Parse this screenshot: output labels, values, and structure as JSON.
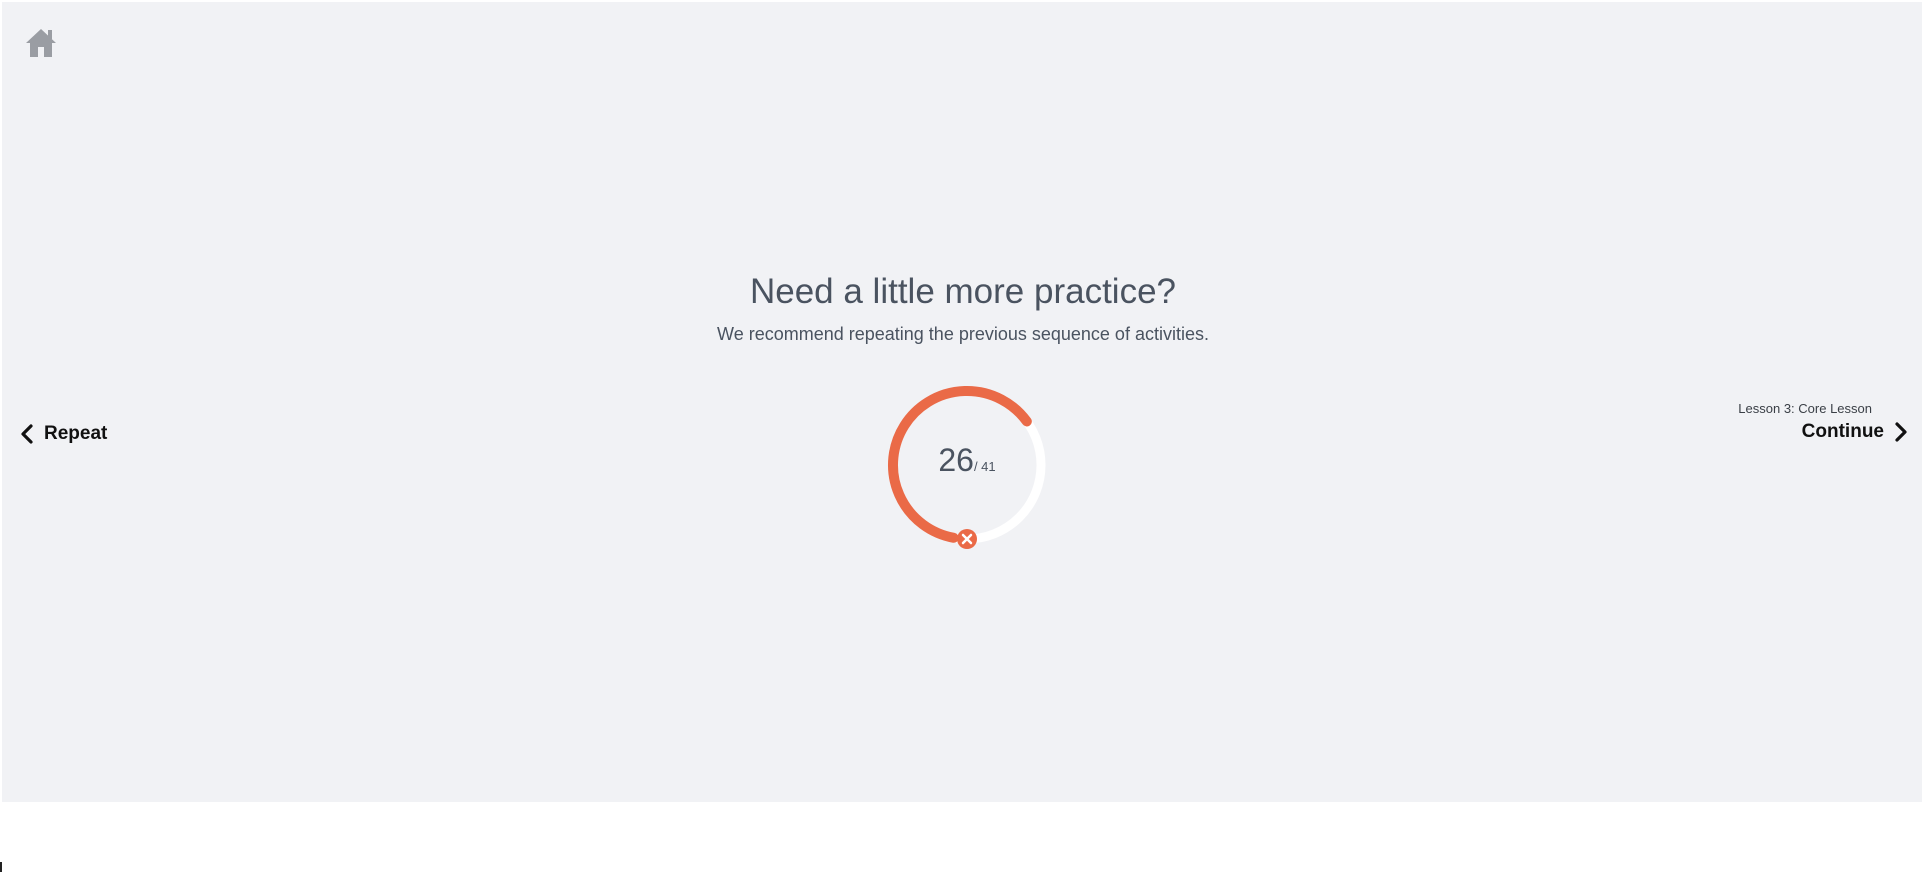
{
  "header": {
    "home_icon": "home-icon"
  },
  "main": {
    "title": "Need a little more practice?",
    "subtitle": "We recommend repeating the previous sequence of activities.",
    "score": {
      "value": "26",
      "total": "/ 41",
      "fraction": 0.634,
      "status_icon": "close-icon",
      "colors": {
        "progress": "#ea6a47",
        "track": "#ffffff"
      }
    }
  },
  "nav": {
    "repeat_label": "Repeat",
    "repeat_icon": "chevron-left-icon",
    "continue_sublabel": "Lesson 3: Core Lesson",
    "continue_label": "Continue",
    "continue_icon": "chevron-right-icon"
  },
  "colors": {
    "background": "#f1f2f5",
    "text": "#4a5360",
    "accent": "#ea6a47"
  }
}
